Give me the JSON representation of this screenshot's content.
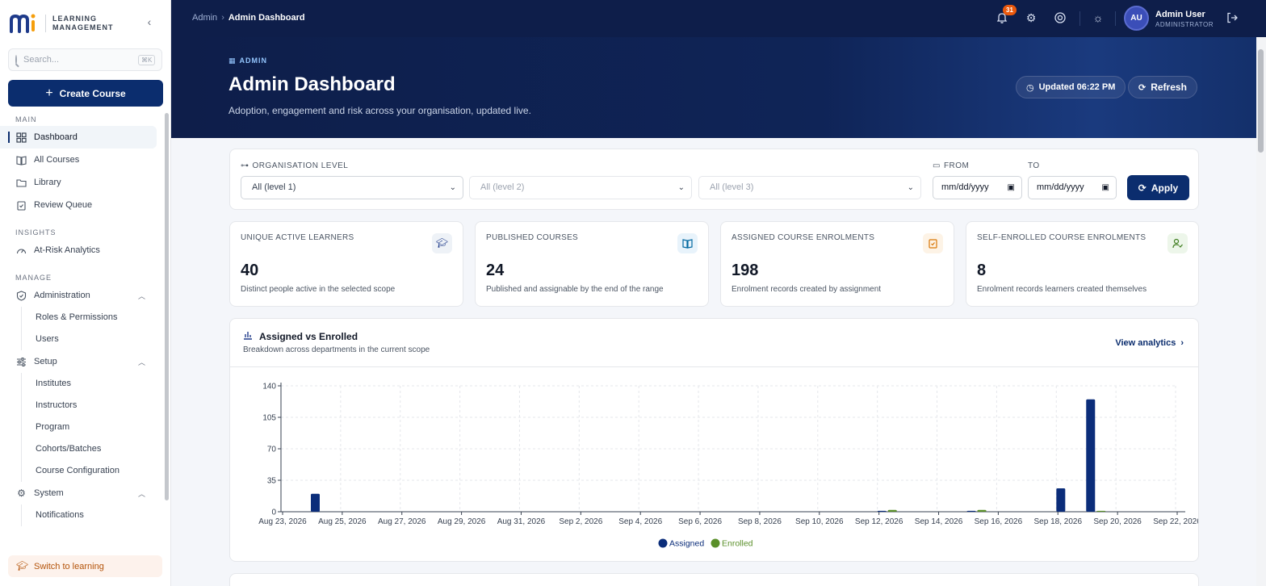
{
  "brand": {
    "line1": "LEARNING",
    "line2": "MANAGEMENT"
  },
  "search": {
    "placeholder": "Search...",
    "shortcut": "⌘K"
  },
  "create_label": "Create Course",
  "nav": {
    "main_label": "MAIN",
    "dashboard": "Dashboard",
    "all_courses": "All Courses",
    "library": "Library",
    "review_queue": "Review Queue",
    "insights_label": "INSIGHTS",
    "at_risk": "At-Risk Analytics",
    "manage_label": "MANAGE",
    "administration": "Administration",
    "roles": "Roles & Permissions",
    "users": "Users",
    "setup": "Setup",
    "institutes": "Institutes",
    "instructors": "Instructors",
    "program": "Program",
    "cohorts": "Cohorts/Batches",
    "course_config": "Course Configuration",
    "system": "System",
    "notifications": "Notifications"
  },
  "switch_label": "Switch to learning",
  "breadcrumb": {
    "root": "Admin",
    "current": "Admin Dashboard"
  },
  "notif_count": "31",
  "user": {
    "initials": "AU",
    "name": "Admin User",
    "role": "ADMINISTRATOR"
  },
  "hero": {
    "tag": "ADMIN",
    "title": "Admin Dashboard",
    "subtitle": "Adoption, engagement and risk across your organisation, updated live.",
    "updated": "Updated 06:22 PM",
    "refresh": "Refresh"
  },
  "filters": {
    "org_label": "ORGANISATION LEVEL",
    "level1": "All (level 1)",
    "level2": "All (level 2)",
    "level3": "All (level 3)",
    "from_label": "FROM",
    "to_label": "TO",
    "from_value": "mm/dd/yyyy",
    "to_value": "mm/dd/yyyy",
    "apply": "Apply"
  },
  "stats": [
    {
      "title": "UNIQUE ACTIVE LEARNERS",
      "value": "40",
      "desc": "Distinct people active in the selected scope"
    },
    {
      "title": "PUBLISHED COURSES",
      "value": "24",
      "desc": "Published and assignable by the end of the range"
    },
    {
      "title": "ASSIGNED COURSE ENROLMENTS",
      "value": "198",
      "desc": "Enrolment records created by assignment"
    },
    {
      "title": "SELF-ENROLLED COURSE ENROLMENTS",
      "value": "8",
      "desc": "Enrolment records learners created themselves"
    }
  ],
  "chart_card": {
    "title": "Assigned vs Enrolled",
    "subtitle": "Breakdown across departments in the current scope",
    "view_link": "View analytics"
  },
  "colors": {
    "assigned": "#0b2d7a",
    "enrolled": "#5a8f29",
    "accent": "#0b2d6e"
  },
  "chart_data": {
    "type": "bar",
    "categories": [
      "Aug 23, 2026",
      "Aug 24, 2026",
      "Aug 25, 2026",
      "Aug 26, 2026",
      "Aug 27, 2026",
      "Aug 28, 2026",
      "Aug 29, 2026",
      "Aug 30, 2026",
      "Aug 31, 2026",
      "Sep 1, 2026",
      "Sep 2, 2026",
      "Sep 3, 2026",
      "Sep 4, 2026",
      "Sep 5, 2026",
      "Sep 6, 2026",
      "Sep 7, 2026",
      "Sep 8, 2026",
      "Sep 9, 2026",
      "Sep 10, 2026",
      "Sep 11, 2026",
      "Sep 12, 2026",
      "Sep 13, 2026",
      "Sep 14, 2026",
      "Sep 15, 2026",
      "Sep 16, 2026",
      "Sep 17, 2026",
      "Sep 18, 2026",
      "Sep 19, 2026",
      "Sep 20, 2026",
      "Sep 21, 2026",
      "Sep 22, 2026"
    ],
    "tick_labels": [
      "Aug 23, 2026",
      "Aug 25, 2026",
      "Aug 27, 2026",
      "Aug 29, 2026",
      "Aug 31, 2026",
      "Sep 2, 2026",
      "Sep 4, 2026",
      "Sep 6, 2026",
      "Sep 8, 2026",
      "Sep 10, 2026",
      "Sep 12, 2026",
      "Sep 14, 2026",
      "Sep 16, 2026",
      "Sep 18, 2026",
      "Sep 20, 2026",
      "Sep 22, 2026"
    ],
    "series": [
      {
        "name": "Assigned",
        "values": [
          20,
          0,
          0,
          0,
          0,
          0,
          0,
          0,
          0,
          0,
          0,
          0,
          0,
          0,
          0,
          0,
          0,
          0,
          0,
          1,
          0,
          0,
          1,
          0,
          0,
          26,
          125,
          0,
          0,
          0,
          0
        ]
      },
      {
        "name": "Enrolled",
        "values": [
          0,
          0,
          0,
          0,
          0,
          0,
          0,
          0,
          0,
          0,
          0,
          0,
          0,
          0,
          0,
          0,
          0,
          0,
          0,
          2,
          0,
          0,
          2,
          0,
          0,
          0,
          1,
          0,
          0,
          0,
          0
        ]
      }
    ],
    "yticks": [
      0,
      35,
      70,
      105,
      140
    ],
    "ylim": [
      0,
      140
    ],
    "grid": true,
    "legend": "bottom-center"
  }
}
